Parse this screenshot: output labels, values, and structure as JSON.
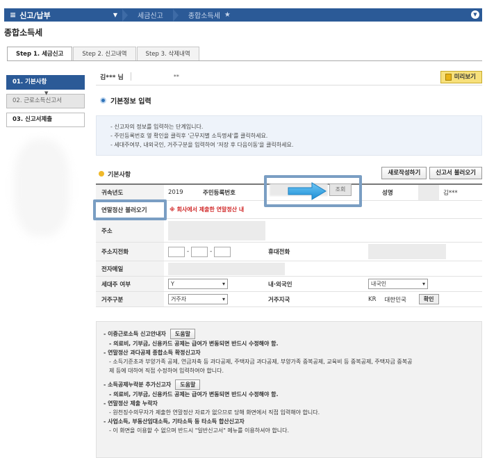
{
  "topbar": {
    "menu": "신고/납부",
    "crumbs": [
      "세금신고",
      "종합소득세"
    ]
  },
  "page_title": "종합소득세",
  "tabs": [
    "Step 1. 세금신고",
    "Step 2. 신고내역",
    "Step 3. 삭제내역"
  ],
  "steps": [
    "01. 기본사항",
    "02. 근로소득신고서",
    "03. 신고서제출"
  ],
  "user": {
    "name": "김*** 님",
    "masked": "**"
  },
  "preview_label": "미리보기",
  "section_title": "기본정보 입력",
  "info_lines": [
    "- 신고자의 정보를 입력하는 단계입니다.",
    "- 주민등록번호 옆 확인을 클릭후 '근무지별 소득명세'를 클릭하세요.",
    "- 세대주여부, 내외국인, 거주구분을 입력하여 '저장 후 다음이동'을 클릭하세요."
  ],
  "basic_title": "기본사항",
  "new_write_btn": "새로작성하기",
  "load_btn": "신고서 불러오기",
  "form": {
    "year_label": "귀속년도",
    "year_value": "2019",
    "rrn_label": "주민등록번호",
    "lookup": "조회",
    "name_label": "성명",
    "name_value": "김***",
    "annual_btn": "연말정산 불러오기",
    "annual_warn": "※ 회사에서 제출한 연말정산 내",
    "address_label": "주소",
    "phone_label": "주소지전화",
    "mobile_label": "휴대전화",
    "email_label": "전자메일",
    "household_label": "세대주 여부",
    "household_value": "Y",
    "nationality_label": "내·외국인",
    "nationality_value": "내국인",
    "residence_label": "거주구분",
    "residence_value": "거주자",
    "country_label": "거주지국",
    "country_code": "KR",
    "country_name": "대한민국",
    "confirm": "확인"
  },
  "notes": {
    "help_label": "도움말",
    "n1_title": "- 이중근로소득 신고안내자",
    "n1_line": "- 의료비, 기부금, 신용카드 공제는 급여가 변동되면 반드시 수정해야 함.",
    "n2_title": "- 연말정산 과다공제 종합소득 확정신고자",
    "n2_line1": "- 소득기준초과 부양가족 공제, 연금저축 등 과다공제, 주택자금 과다공제, 부양가족 중복공제, 교육비 등 중복공제, 주택자금 중복공",
    "n2_line2": "제 등에 대하여 직접 수정하여 입력하여야 합니다.",
    "n3_title": "- 소득공제누락분 추가신고자",
    "n3_line": "- 의료비, 기부금, 신용카드 공제는 급여가 변동되면 반드시 수정해야 함.",
    "n4_title": "- 연말정산 제출 누락자",
    "n4_line": "- 원천징수의무자가 제출한 연말정산 자료가 없으므로 당해 화면에서 직접 입력해야 합니다.",
    "n5_title": "- 사업소득, 부동산임대소득, 기타소득 등 타소득 합산신고자",
    "n5_line": "- 이 화면을 이용할 수 없으며 반드시 \"일반신고서\" 메뉴를 이용하셔야 합니다."
  },
  "colors": {
    "nav": "#2b5a97",
    "highlight": "#7a9ec3",
    "arrow": "#2f9fe0",
    "warn": "#d12a2a"
  }
}
